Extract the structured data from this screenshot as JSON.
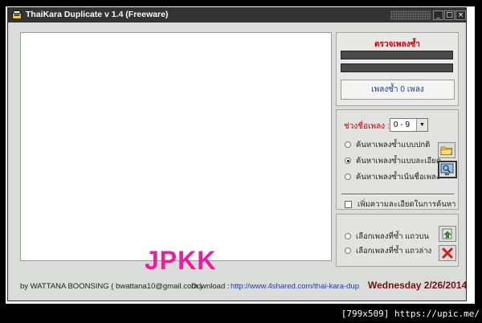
{
  "window": {
    "title": "ThaiKara Duplicate v 1.4  (Freeware)",
    "controls": [
      "_",
      "□",
      "×"
    ]
  },
  "results_panel": {
    "title": "ตรวจเพลงซ้ำ",
    "count_text": "เพลงซ้ำ  0  เพลง"
  },
  "search_panel": {
    "range_label": "ช่วงชื่อเพลง :",
    "range_value": "0 - 9",
    "options": [
      {
        "label": "ค้นหาเพลงซ้ำแบบปกติ",
        "selected": false
      },
      {
        "label": "ค้นหาเพลงซ้ำแบบละเอียด",
        "selected": true
      },
      {
        "label": "ค้นหาเพลงซ้ำเน้นชื่อเพลง",
        "selected": false
      }
    ],
    "detail_checkbox_label": "เพิ่มความละเอียดในการค้นหา",
    "detail_checked": false
  },
  "select_panel": {
    "options": [
      {
        "label": "เลือกเพลงที่ซ้ำ แถวบน",
        "selected": false
      },
      {
        "label": "เลือกเพลงที่ซ้ำ แถวล่าง",
        "selected": false
      }
    ]
  },
  "overlay_text": "JPKK",
  "status": {
    "author": "by WATTANA  BOONSING  ( bwattana10@gmail.com )",
    "download_label": "Download :",
    "download_url": "http://www.4shared.com/thai-kara-dup",
    "date": "Wednesday 2/26/2014"
  },
  "watermark": "[799x509] https://upic.me/",
  "colors": {
    "accent_red": "#cc0000",
    "link_blue": "#1f3fb0",
    "date_color": "#7a0f0f",
    "overlay_pink": "#ee1c9e",
    "window_bg": "#d9dcd8",
    "titlebar_bg": "#333333"
  }
}
